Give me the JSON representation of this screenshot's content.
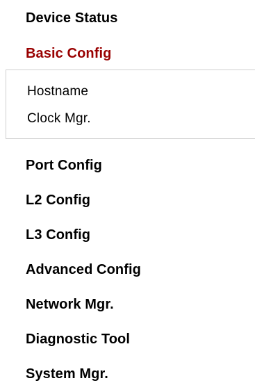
{
  "colors": {
    "text": "#000000",
    "active": "#990000",
    "submenu_border": "#cfcfcf",
    "background": "#ffffff"
  },
  "nav": {
    "device_status": "Device Status",
    "basic_config": "Basic Config",
    "basic_config_sub": {
      "hostname": "Hostname",
      "clock_mgr": "Clock Mgr."
    },
    "port_config": "Port Config",
    "l2_config": "L2 Config",
    "l3_config": "L3 Config",
    "advanced_config": "Advanced Config",
    "network_mgr": "Network Mgr.",
    "diagnostic_tool": "Diagnostic Tool",
    "system_mgr": "System Mgr.",
    "active_item": "Basic Config"
  }
}
